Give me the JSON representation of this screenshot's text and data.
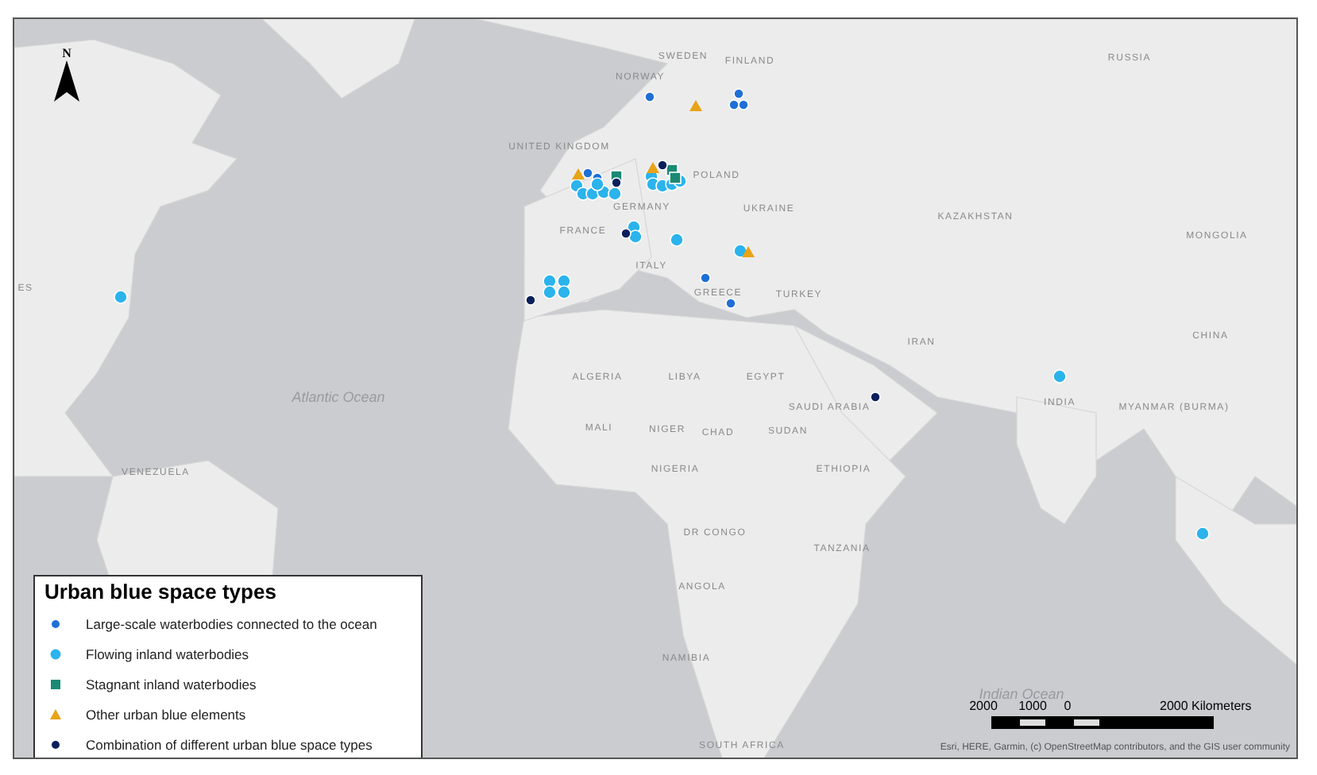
{
  "map": {
    "compass_letter": "N",
    "labels": [
      {
        "text": "SWEDEN",
        "kind": "country"
      },
      {
        "text": "FINLAND",
        "kind": "country"
      },
      {
        "text": "RUSSIA",
        "kind": "country"
      },
      {
        "text": "NORWAY",
        "kind": "country"
      },
      {
        "text": "UNITED KINGDOM",
        "kind": "country"
      },
      {
        "text": "GERMANY",
        "kind": "country"
      },
      {
        "text": "POLAND",
        "kind": "country"
      },
      {
        "text": "UKRAINE",
        "kind": "country"
      },
      {
        "text": "KAZAKHSTAN",
        "kind": "country"
      },
      {
        "text": "MONGOLIA",
        "kind": "country"
      },
      {
        "text": "FRANCE",
        "kind": "country"
      },
      {
        "text": "ITALY",
        "kind": "country"
      },
      {
        "text": "GREECE",
        "kind": "country"
      },
      {
        "text": "TURKEY",
        "kind": "country"
      },
      {
        "text": "IRAN",
        "kind": "country"
      },
      {
        "text": "CHINA",
        "kind": "country"
      },
      {
        "text": "SAUDI ARABIA",
        "kind": "country"
      },
      {
        "text": "INDIA",
        "kind": "country"
      },
      {
        "text": "MYANMAR (BURMA)",
        "kind": "country"
      },
      {
        "text": "ES",
        "kind": "country"
      },
      {
        "text": "Atlantic Ocean",
        "kind": "ocean"
      },
      {
        "text": "ALGERIA",
        "kind": "country"
      },
      {
        "text": "LIBYA",
        "kind": "country"
      },
      {
        "text": "EGYPT",
        "kind": "country"
      },
      {
        "text": "MALI",
        "kind": "country"
      },
      {
        "text": "NIGER",
        "kind": "country"
      },
      {
        "text": "CHAD",
        "kind": "country"
      },
      {
        "text": "SUDAN",
        "kind": "country"
      },
      {
        "text": "NIGERIA",
        "kind": "country"
      },
      {
        "text": "ETHIOPIA",
        "kind": "country"
      },
      {
        "text": "VENEZUELA",
        "kind": "country"
      },
      {
        "text": "DR CONGO",
        "kind": "country"
      },
      {
        "text": "TANZANIA",
        "kind": "country"
      },
      {
        "text": "ANGOLA",
        "kind": "country"
      },
      {
        "text": "NAMIBIA",
        "kind": "country"
      },
      {
        "text": "Indian Ocean",
        "kind": "ocean"
      },
      {
        "text": "SOUTH AFRICA",
        "kind": "country"
      }
    ],
    "sites": [
      {
        "kind": "large"
      },
      {
        "kind": "large"
      },
      {
        "kind": "large"
      },
      {
        "kind": "large"
      },
      {
        "kind": "large"
      },
      {
        "kind": "large"
      },
      {
        "kind": "large"
      },
      {
        "kind": "large"
      },
      {
        "kind": "flowing"
      },
      {
        "kind": "flowing"
      },
      {
        "kind": "flowing"
      },
      {
        "kind": "flowing"
      },
      {
        "kind": "flowing"
      },
      {
        "kind": "flowing"
      },
      {
        "kind": "flowing"
      },
      {
        "kind": "flowing"
      },
      {
        "kind": "flowing"
      },
      {
        "kind": "flowing"
      },
      {
        "kind": "flowing"
      },
      {
        "kind": "flowing"
      },
      {
        "kind": "flowing"
      },
      {
        "kind": "flowing"
      },
      {
        "kind": "flowing"
      },
      {
        "kind": "flowing"
      },
      {
        "kind": "flowing"
      },
      {
        "kind": "flowing"
      },
      {
        "kind": "flowing"
      },
      {
        "kind": "flowing"
      },
      {
        "kind": "flowing"
      },
      {
        "kind": "flowing"
      },
      {
        "kind": "stagnant"
      },
      {
        "kind": "stagnant"
      },
      {
        "kind": "stagnant"
      },
      {
        "kind": "other"
      },
      {
        "kind": "other"
      },
      {
        "kind": "other"
      },
      {
        "kind": "other"
      },
      {
        "kind": "combination"
      },
      {
        "kind": "combination"
      },
      {
        "kind": "combination"
      },
      {
        "kind": "combination"
      },
      {
        "kind": "combination"
      }
    ]
  },
  "legend": {
    "title": "Urban blue space types",
    "items": [
      {
        "kind": "large",
        "label": "Large-scale waterbodies connected to the ocean",
        "color": "#1f6fd6"
      },
      {
        "kind": "flowing",
        "label": "Flowing inland waterbodies",
        "color": "#2bb3ec"
      },
      {
        "kind": "stagnant",
        "label": "Stagnant inland waterbodies",
        "color": "#1a8a74"
      },
      {
        "kind": "other",
        "label": "Other urban blue elements",
        "color": "#e8a317"
      },
      {
        "kind": "combination",
        "label": "Combination of different urban blue space types",
        "color": "#0b1f5c"
      }
    ]
  },
  "scale_bar": {
    "ticks": [
      "2000",
      "1000",
      "0",
      "2000 Kilometers"
    ]
  },
  "attribution": "Esri, HERE, Garmin, (c) OpenStreetMap contributors, and the GIS user community"
}
